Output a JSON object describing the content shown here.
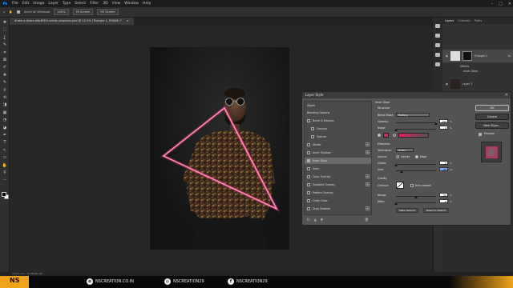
{
  "app": {
    "logo": "Ps",
    "menu": [
      "File",
      "Edit",
      "Image",
      "Layer",
      "Type",
      "Select",
      "Filter",
      "3D",
      "View",
      "Window",
      "Help"
    ],
    "window_controls": [
      "–",
      "□",
      "✕"
    ]
  },
  "options_bar": {
    "scroll_all": "Scroll All Windows",
    "zoom": "100%",
    "fit_screen": "Fit Screen",
    "fill_screen": "Fill Screen"
  },
  "document": {
    "tab_title": "drake-x-takes-e8a6f3f4-reheb-unsplash.psd @ 12.5% (Triangle 1, RGB/8) *",
    "tab_close": "×",
    "status": "12.5%   Doc: 15.8M/85.3M"
  },
  "tools": [
    "move-tool",
    "marquee-tool",
    "lasso-tool",
    "quick-select-tool",
    "crop-tool",
    "frame-tool",
    "eyedropper-tool",
    "healing-tool",
    "brush-tool",
    "stamp-tool",
    "history-brush-tool",
    "eraser-tool",
    "gradient-tool",
    "blur-tool",
    "dodge-tool",
    "pen-tool",
    "type-tool",
    "path-select-tool",
    "shape-tool",
    "hand-tool",
    "zoom-tool",
    "more-tools"
  ],
  "tool_glyphs": [
    "✥",
    "⬚",
    "ʆ",
    "✎",
    "⌗",
    "⊠",
    "✐",
    "✚",
    "✎",
    "⚲",
    "⟲",
    "◨",
    "▦",
    "◔",
    "◕",
    "✒",
    "T",
    "↖",
    "▭",
    "✋",
    "⚲",
    "⋯"
  ],
  "layers_panel": {
    "tabs": [
      "Layers",
      "Channels",
      "Paths"
    ],
    "active_tab": "Layers",
    "layers": [
      {
        "name": "Triangle 1",
        "fx": "fx"
      },
      {
        "name": "Effects"
      },
      {
        "name": "Inner Glow"
      },
      {
        "name": "Layer 1"
      }
    ]
  },
  "dialog": {
    "title": "Layer Style",
    "close": "✕",
    "styles_header": "Styles",
    "blending_options": "Blending Options",
    "items": [
      {
        "label": "Bevel & Emboss",
        "checked": false
      },
      {
        "label": "Contour",
        "checked": false,
        "indent": true
      },
      {
        "label": "Texture",
        "checked": false,
        "indent": true
      },
      {
        "label": "Stroke",
        "checked": false,
        "plus": true
      },
      {
        "label": "Inner Shadow",
        "checked": false,
        "plus": true
      },
      {
        "label": "Inner Glow",
        "checked": true,
        "selected": true
      },
      {
        "label": "Satin",
        "checked": false
      },
      {
        "label": "Color Overlay",
        "checked": false,
        "plus": true
      },
      {
        "label": "Gradient Overlay",
        "checked": false,
        "plus": true
      },
      {
        "label": "Pattern Overlay",
        "checked": false
      },
      {
        "label": "Outer Glow",
        "checked": false
      },
      {
        "label": "Drop Shadow",
        "checked": false,
        "plus": true
      }
    ],
    "bottom_icons": [
      "fx",
      "▲",
      "▼",
      "🗑"
    ],
    "inner_glow": {
      "title": "Inner Glow",
      "structure": "Structure",
      "blend_mode_label": "Blend Mode:",
      "blend_mode": "Multiply",
      "opacity_label": "Opacity:",
      "opacity": "100",
      "noise_label": "Noise:",
      "noise": "0",
      "percent": "%",
      "glow_color": "#d9245e",
      "elements": "Elements",
      "technique_label": "Technique:",
      "technique": "Softer",
      "source_label": "Source:",
      "source_center": "Center",
      "source_edge": "Edge",
      "choke_label": "Choke:",
      "choke": "0",
      "size_label": "Size:",
      "size": "30",
      "px": "px",
      "quality": "Quality",
      "contour_label": "Contour:",
      "anti_aliased": "Anti-aliased",
      "range_label": "Range:",
      "range": "50",
      "jitter_label": "Jitter:",
      "jitter": "0",
      "make_default": "Make Default",
      "reset_default": "Reset to Default"
    },
    "buttons": {
      "ok": "OK",
      "cancel": "Cancel",
      "new_style": "New Style...",
      "preview": "Preview"
    },
    "preview_color": "#c22a5a"
  },
  "footer": {
    "logo": "NS",
    "website": "NSCREATION.CO.IN",
    "instagram": "NSCREATION29",
    "facebook": "NSCREATION29",
    "accent": "#f0a21b"
  },
  "colors": {
    "triangle_stroke": "#ff6fa5",
    "glow": "#ff2f7a"
  }
}
